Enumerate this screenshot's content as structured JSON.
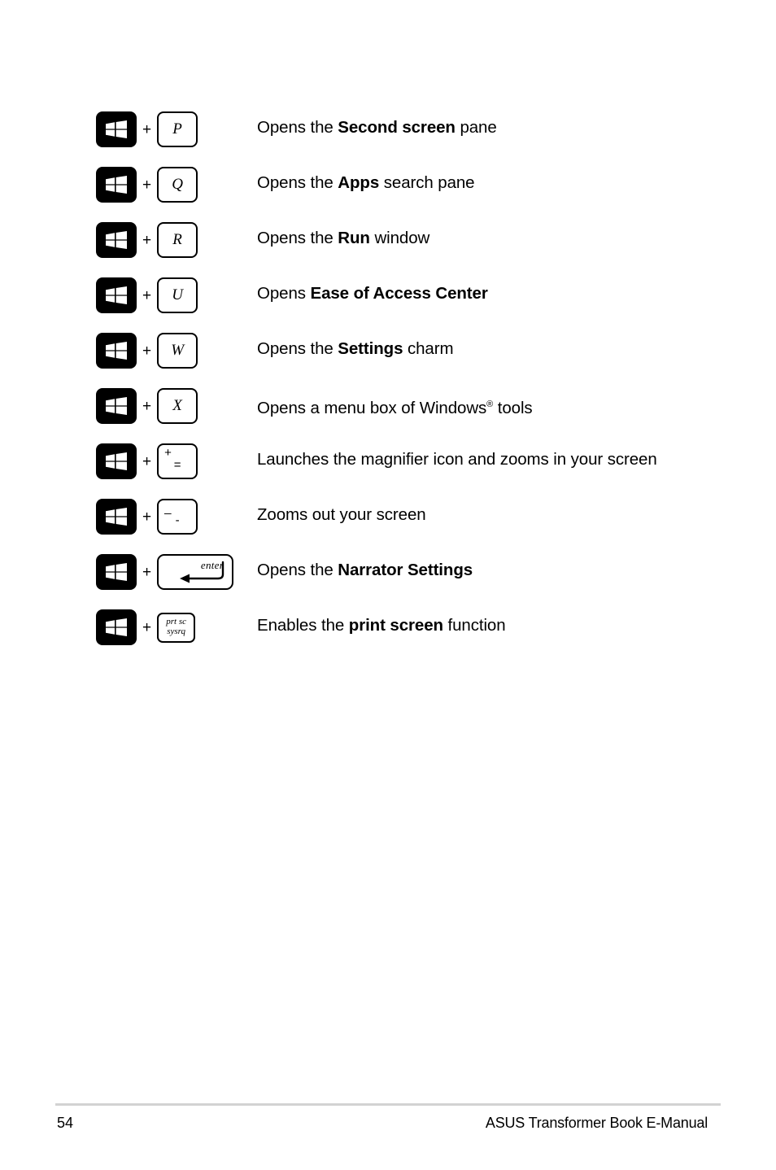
{
  "document": {
    "page_number": "54",
    "footer_title": "ASUS Transformer Book E-Manual"
  },
  "shortcuts": [
    {
      "modifier": "windows-key",
      "key_type": "letter",
      "key_label": "P",
      "description_prefix": "Opens the ",
      "description_bold": "Second screen",
      "description_suffix": " pane"
    },
    {
      "modifier": "windows-key",
      "key_type": "letter",
      "key_label": "Q",
      "description_prefix": "Opens the ",
      "description_bold": "Apps",
      "description_suffix": " search pane"
    },
    {
      "modifier": "windows-key",
      "key_type": "letter",
      "key_label": "R",
      "description_prefix": "Opens the ",
      "description_bold": "Run",
      "description_suffix": " window"
    },
    {
      "modifier": "windows-key",
      "key_type": "letter",
      "key_label": "U",
      "description_prefix": "Opens ",
      "description_bold": "Ease of Access Center",
      "description_suffix": ""
    },
    {
      "modifier": "windows-key",
      "key_type": "letter",
      "key_label": "W",
      "description_prefix": "Opens the ",
      "description_bold": "Settings",
      "description_suffix": " charm"
    },
    {
      "modifier": "windows-key",
      "key_type": "letter",
      "key_label": "X",
      "description_prefix": "Opens a menu box of Windows",
      "description_bold": "",
      "description_suffix": " tools",
      "has_registered_mark": true,
      "registered_mark": "®"
    },
    {
      "modifier": "windows-key",
      "key_type": "dual",
      "key_sup": "+",
      "key_main": "=",
      "description_prefix": "Launches the magnifier icon and zooms in your screen",
      "description_bold": "",
      "description_suffix": ""
    },
    {
      "modifier": "windows-key",
      "key_type": "dual",
      "key_sup": "_",
      "key_main": "-",
      "description_prefix": "Zooms out your screen",
      "description_bold": "",
      "description_suffix": ""
    },
    {
      "modifier": "windows-key",
      "key_type": "enter",
      "key_label": "enter",
      "description_prefix": "Opens the ",
      "description_bold": "Narrator Settings",
      "description_suffix": ""
    },
    {
      "modifier": "windows-key",
      "key_type": "prtsc",
      "key_line1": "prt sc",
      "key_line2": "sysrq",
      "description_prefix": "Enables the ",
      "description_bold": "print screen",
      "description_suffix": " function"
    }
  ],
  "symbols": {
    "plus": "+"
  },
  "colors": {
    "text": "#000000",
    "key_fill": "#ffffff",
    "win_key_fill": "#000000",
    "footer_rule": "#d2d2d2"
  }
}
